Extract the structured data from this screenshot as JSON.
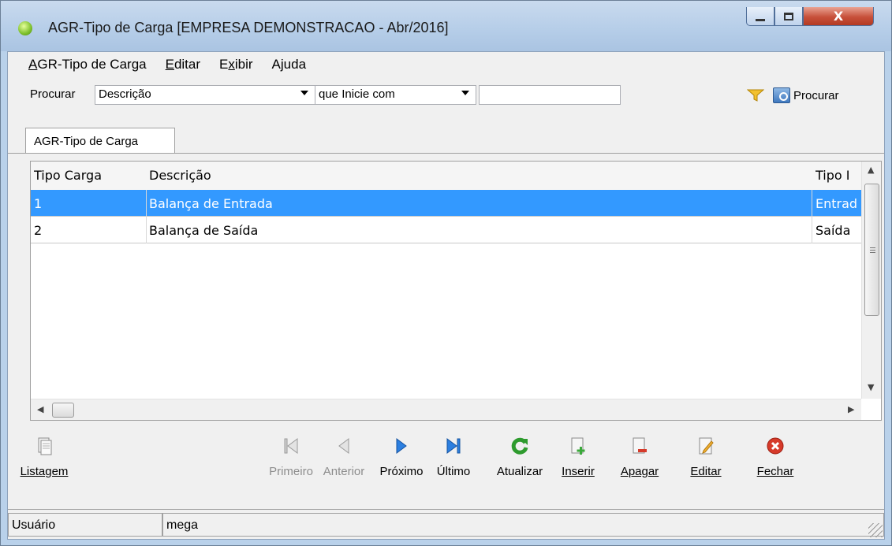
{
  "window": {
    "title": "AGR-Tipo de Carga [EMPRESA DEMONSTRACAO - Abr/2016]",
    "close_glyph": "X"
  },
  "menu": [
    {
      "pre": "",
      "u": "A",
      "post": "GR-Tipo de Carga"
    },
    {
      "pre": "",
      "u": "E",
      "post": "ditar"
    },
    {
      "pre": "E",
      "u": "x",
      "post": "ibir"
    },
    {
      "pre": "A",
      "u": "j",
      "post": "uda"
    }
  ],
  "search": {
    "label": "Procurar",
    "field_value": "Descrição",
    "condition_value": "que Inicie com",
    "text_value": "",
    "button_label": "Procurar"
  },
  "tab": {
    "label": "AGR-Tipo de Carga"
  },
  "grid": {
    "headers": [
      "Tipo Carga",
      "Descrição",
      "Tipo I"
    ],
    "rows": [
      {
        "tipo": "1",
        "descricao": "Balança de Entrada",
        "tipo_mov": "Entrad",
        "selected": true
      },
      {
        "tipo": "2",
        "descricao": "Balança de Saída",
        "tipo_mov": "Saída",
        "selected": false
      }
    ]
  },
  "toolbar": {
    "listagem": "Listagem",
    "primeiro": "Primeiro",
    "anterior": "Anterior",
    "proximo": "Próximo",
    "ultimo": "Último",
    "atualizar": "Atualizar",
    "inserir": "Inserir",
    "apagar": "Apagar",
    "editar": "Editar",
    "fechar": "Fechar"
  },
  "status": {
    "label": "Usuário",
    "user": "mega"
  },
  "colors": {
    "selection": "#3399ff",
    "nav_blue": "#1f6fd1",
    "refresh_green": "#2e9b2e",
    "close_red": "#d63a2a"
  }
}
